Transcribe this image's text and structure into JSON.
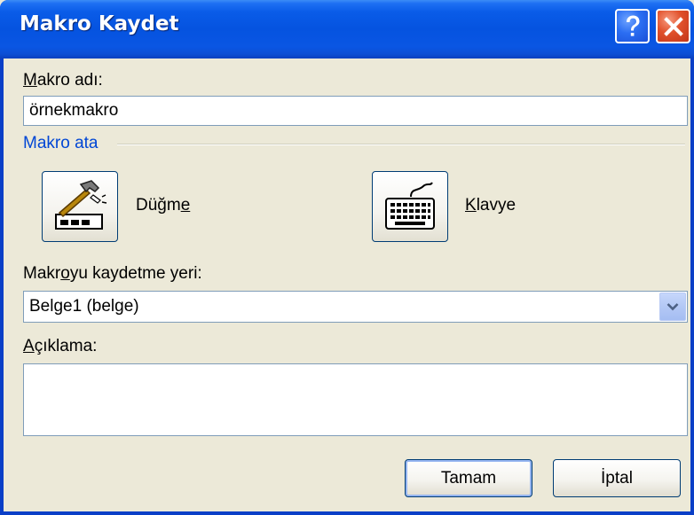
{
  "window": {
    "title": "Makro Kaydet",
    "help_glyph": "?",
    "close_glyph": "✕"
  },
  "form": {
    "macro_name_label_acc": "M",
    "macro_name_label_rest": "akro adı:",
    "macro_name_value": "örnekmakro",
    "assign_group_title": "Makro ata",
    "button_option_label_pre": "Düğm",
    "button_option_label_acc": "e",
    "keyboard_option_label_acc": "K",
    "keyboard_option_label_rest": "lavye",
    "store_label_pre": "Makr",
    "store_label_acc": "o",
    "store_label_rest": "yu kaydetme yeri:",
    "store_value": "Belge1 (belge)",
    "description_label_acc": "A",
    "description_label_rest": "çıklama:",
    "description_value": ""
  },
  "buttons": {
    "ok_label": "Tamam",
    "cancel_label": "İptal"
  },
  "icons": {
    "help": "help-icon",
    "close": "close-icon",
    "button_assign": "hammer-toolbar-icon",
    "keyboard_assign": "keyboard-icon",
    "dropdown": "chevron-down-icon"
  },
  "colors": {
    "title_bar": "#0553e0",
    "group_title": "#0046d5",
    "close_button": "#e0502a",
    "dialog_background": "#ece9d8"
  }
}
